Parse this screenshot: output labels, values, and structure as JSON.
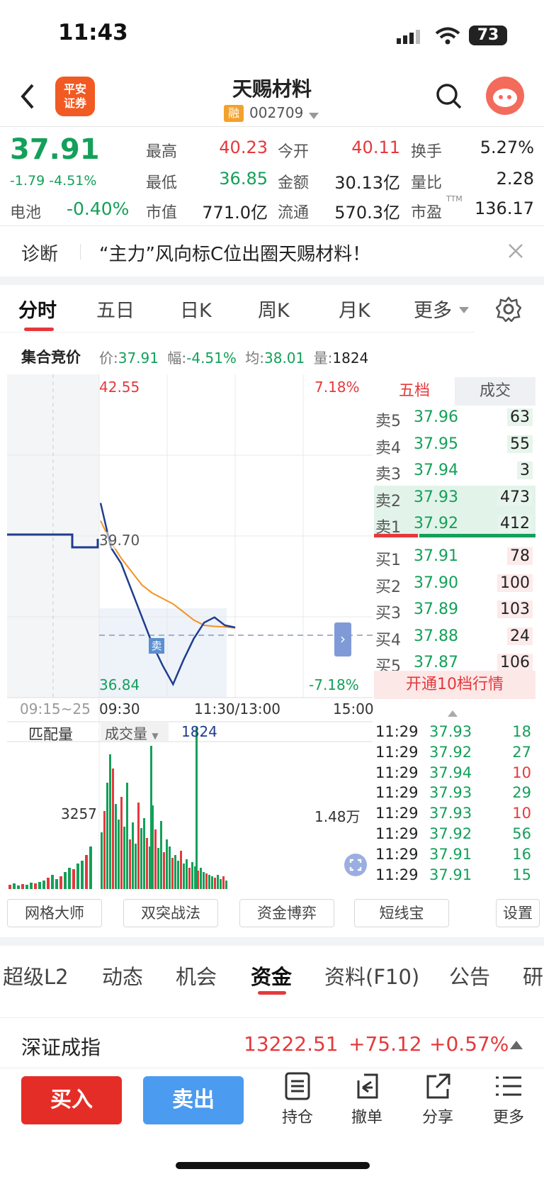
{
  "status": {
    "time": "11:43",
    "battery": "73"
  },
  "header": {
    "title": "天赐材料",
    "margin_badge": "融",
    "code": "002709",
    "broker_logo": "平安\n证券"
  },
  "quote": {
    "price": "37.91",
    "change": "-1.79",
    "change_pct": "-4.51%",
    "sector_label": "电池",
    "sector_pct": "-0.40%",
    "fields": [
      {
        "label": "最高",
        "value": "40.23",
        "color": "red"
      },
      {
        "label": "今开",
        "value": "40.11",
        "color": "red"
      },
      {
        "label": "换手",
        "value": "5.27%",
        "color": "dark"
      },
      {
        "label": "最低",
        "value": "36.85",
        "color": "green"
      },
      {
        "label": "金额",
        "value": "30.13亿",
        "color": "dark"
      },
      {
        "label": "量比",
        "value": "2.28",
        "color": "dark"
      },
      {
        "label": "市值",
        "value": "771.0亿",
        "color": "dark"
      },
      {
        "label": "流通",
        "value": "570.3亿",
        "color": "dark"
      },
      {
        "label": "市盈",
        "value": "136.17",
        "color": "dark",
        "sup": "TTM"
      }
    ]
  },
  "diagnosis": {
    "label": "诊断",
    "text": "“主力”风向标C位出圈天赐材料！"
  },
  "chart_tabs": [
    "分时",
    "五日",
    "日K",
    "周K",
    "月K",
    "更多"
  ],
  "auction": {
    "label": "集合竞价",
    "price_label": "价:",
    "price": "37.91",
    "pct_label": "幅:",
    "pct": "-4.51%",
    "avg_label": "均:",
    "avg": "38.01",
    "vol_label": "量:",
    "vol": "1824"
  },
  "chart_labels": {
    "high": "42.55",
    "high_pct": "7.18%",
    "mid": "39.70",
    "low": "36.84",
    "low_pct": "-7.18%",
    "t0": "09:15~25",
    "t1": "09:30",
    "t2": "11:30/13:00",
    "t3": "15:00",
    "match_vol": "匹配量",
    "vol_select": "成交量",
    "vol_value": "1824",
    "vol_left": "3257",
    "vol_right": "1.48万",
    "sell_tag": "卖"
  },
  "chart_data": {
    "type": "line",
    "title": "",
    "ylim": [
      36.84,
      42.55
    ],
    "series": [
      {
        "values": [
          39.9,
          39.5,
          39.2,
          38.95,
          38.7,
          38.55,
          38.45,
          38.35,
          38.2,
          38.05,
          37.95,
          37.93,
          37.92,
          37.9
        ]
      },
      {
        "values": [
          40.23,
          39.4,
          39.1,
          38.6,
          38.1,
          37.6,
          37.2,
          36.85,
          37.3,
          37.7,
          38.0,
          38.1,
          37.95,
          37.91
        ]
      }
    ]
  },
  "order_book": {
    "tabs": [
      "五档",
      "成交"
    ],
    "rows": [
      {
        "label": "卖5",
        "price": "37.96",
        "vol": "63"
      },
      {
        "label": "卖4",
        "price": "37.95",
        "vol": "55"
      },
      {
        "label": "卖3",
        "price": "37.94",
        "vol": "3"
      },
      {
        "label": "卖2",
        "price": "37.93",
        "vol": "473"
      },
      {
        "label": "卖1",
        "price": "37.92",
        "vol": "412"
      },
      {
        "label": "买1",
        "price": "37.91",
        "vol": "78"
      },
      {
        "label": "买2",
        "price": "37.90",
        "vol": "100"
      },
      {
        "label": "买3",
        "price": "37.89",
        "vol": "103"
      },
      {
        "label": "买4",
        "price": "37.88",
        "vol": "24"
      },
      {
        "label": "买5",
        "price": "37.87",
        "vol": "106"
      }
    ],
    "upgrade": "开通10档行情"
  },
  "ticks": [
    {
      "time": "11:29",
      "price": "37.93",
      "vol": "18",
      "color": "green"
    },
    {
      "time": "11:29",
      "price": "37.92",
      "vol": "27",
      "color": "green"
    },
    {
      "time": "11:29",
      "price": "37.94",
      "vol": "10",
      "color": "red"
    },
    {
      "time": "11:29",
      "price": "37.93",
      "vol": "29",
      "color": "green"
    },
    {
      "time": "11:29",
      "price": "37.93",
      "vol": "10",
      "color": "red"
    },
    {
      "time": "11:29",
      "price": "37.92",
      "vol": "56",
      "color": "green"
    },
    {
      "time": "11:29",
      "price": "37.91",
      "vol": "16",
      "color": "green"
    },
    {
      "time": "11:29",
      "price": "37.91",
      "vol": "15",
      "color": "green"
    }
  ],
  "tools": [
    "网格大师",
    "双突战法",
    "资金博弈",
    "短线宝",
    "设置"
  ],
  "sub_tabs": [
    "超级L2",
    "动态",
    "机会",
    "资金",
    "资料(F10)",
    "公告",
    "研"
  ],
  "index": {
    "name": "深证成指",
    "value": "13222.51",
    "change": "+75.12",
    "pct": "+0.57%"
  },
  "actions": {
    "buy": "买入",
    "sell": "卖出",
    "icons": [
      "持仓",
      "撤单",
      "分享",
      "更多"
    ]
  }
}
